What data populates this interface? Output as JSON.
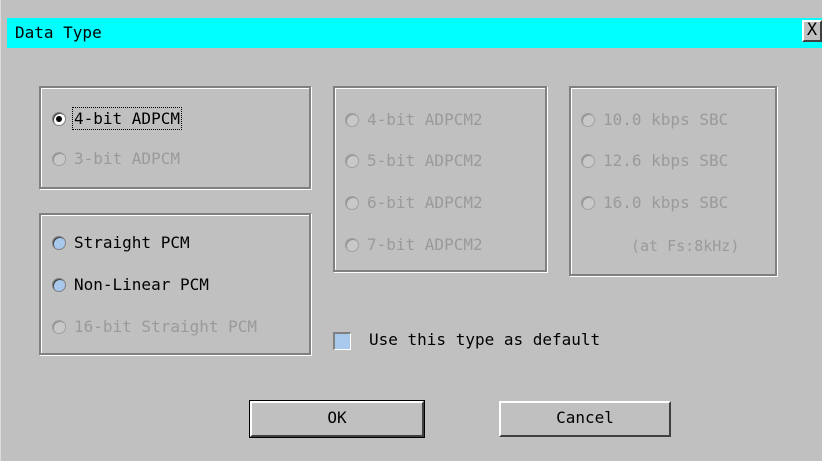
{
  "window": {
    "title": "Data Type",
    "close_label": "X"
  },
  "group_adpcm": {
    "options": [
      {
        "label": "4-bit ADPCM",
        "selected": true,
        "enabled": true
      },
      {
        "label": "3-bit ADPCM",
        "selected": false,
        "enabled": false
      }
    ]
  },
  "group_pcm": {
    "options": [
      {
        "label": "Straight PCM",
        "selected": false,
        "enabled": true
      },
      {
        "label": "Non-Linear PCM",
        "selected": false,
        "enabled": true
      },
      {
        "label": "16-bit Straight PCM",
        "selected": false,
        "enabled": false
      }
    ]
  },
  "group_adpcm2": {
    "options": [
      {
        "label": "4-bit ADPCM2",
        "selected": false,
        "enabled": false
      },
      {
        "label": "5-bit ADPCM2",
        "selected": false,
        "enabled": false
      },
      {
        "label": "6-bit ADPCM2",
        "selected": false,
        "enabled": false
      },
      {
        "label": "7-bit ADPCM2",
        "selected": false,
        "enabled": false
      }
    ]
  },
  "group_sbc": {
    "options": [
      {
        "label": "10.0 kbps SBC",
        "selected": false,
        "enabled": false
      },
      {
        "label": "12.6 kbps SBC",
        "selected": false,
        "enabled": false
      },
      {
        "label": "16.0 kbps SBC",
        "selected": false,
        "enabled": false
      }
    ],
    "note": "(at Fs:8kHz)"
  },
  "default_checkbox": {
    "label": "Use this type as default",
    "checked": false
  },
  "buttons": {
    "ok": "OK",
    "cancel": "Cancel"
  },
  "colors": {
    "titlebar": "#00ffff",
    "face": "#c0c0c0",
    "radio_fill": "#a8c8ec",
    "disabled_text": "#9a9a9a"
  }
}
